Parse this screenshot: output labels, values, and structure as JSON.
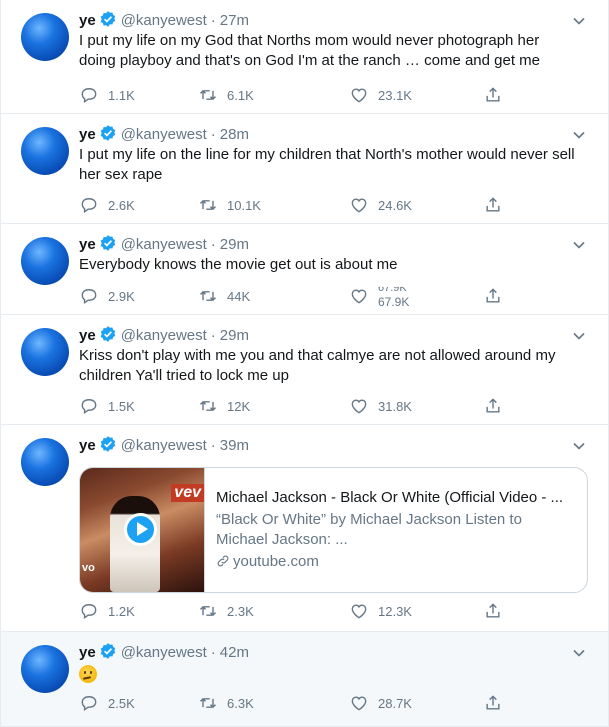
{
  "tweets": [
    {
      "name": "ye",
      "handle": "@kanyewest",
      "time": "27m",
      "text": "I put my life on my God that Norths mom would never photograph her doing playboy and that's on God    I'm at the ranch … come and get me",
      "replies": "1.1K",
      "retweets": "6.1K",
      "likes": "23.1K"
    },
    {
      "name": "ye",
      "handle": "@kanyewest",
      "time": "28m",
      "text": "I put my life on the line for my children that North's mother would never sell her sex rape",
      "replies": "2.6K",
      "retweets": "10.1K",
      "likes": "24.6K"
    },
    {
      "name": "ye",
      "handle": "@kanyewest",
      "time": "29m",
      "text": "Everybody knows the movie get out is about me",
      "replies": "2.9K",
      "retweets": "44K",
      "likes": "67.9K",
      "likes_prev": "67.9K"
    },
    {
      "name": "ye",
      "handle": "@kanyewest",
      "time": "29m",
      "text": "Kriss don't play with me  you and that calmye are not allowed around my children   Ya'll tried to lock me up",
      "replies": "1.5K",
      "retweets": "12K",
      "likes": "31.8K"
    },
    {
      "name": "ye",
      "handle": "@kanyewest",
      "time": "39m",
      "card": {
        "title": "Michael Jackson - Black Or White (Official Video - ...",
        "description": "“Black Or White” by Michael Jackson Listen to Michael Jackson: ...",
        "domain": "youtube.com",
        "thumb_badge": "vev",
        "thumb_corner": "vo"
      },
      "replies": "1.2K",
      "retweets": "2.3K",
      "likes": "12.3K"
    },
    {
      "name": "ye",
      "handle": "@kanyewest",
      "time": "42m",
      "emoji": "thinking-face",
      "replies": "2.5K",
      "retweets": "6.3K",
      "likes": "28.7K"
    }
  ],
  "colors": {
    "accent": "#1da1f2",
    "muted": "#657786",
    "text": "#14171a",
    "border": "#e6ecf0",
    "highlight": "#f5f8fa"
  }
}
